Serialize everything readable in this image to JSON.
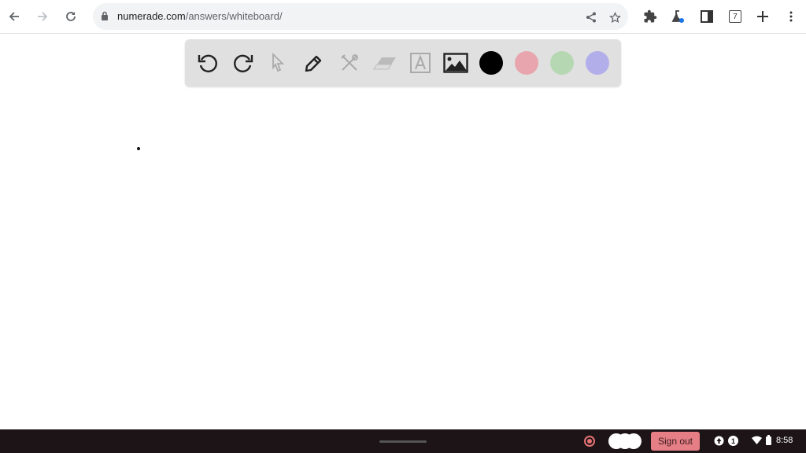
{
  "browser": {
    "url_host": "numerade.com",
    "url_path": "/answers/whiteboard/",
    "tab_count": "7",
    "nav": {
      "back": "back-arrow",
      "forward": "forward-arrow",
      "reload": "reload"
    },
    "toolbar_icons": [
      "share",
      "bookmark-star",
      "extensions-puzzle",
      "labs-flask",
      "side-panel",
      "tab-count",
      "new-tab-plus",
      "menu-kebab"
    ]
  },
  "whiteboard": {
    "tools": [
      {
        "name": "undo",
        "enabled": true
      },
      {
        "name": "redo",
        "enabled": true
      },
      {
        "name": "select",
        "enabled": false
      },
      {
        "name": "pen",
        "enabled": true
      },
      {
        "name": "tools",
        "enabled": false
      },
      {
        "name": "eraser",
        "enabled": false
      },
      {
        "name": "text",
        "enabled": false
      },
      {
        "name": "image",
        "enabled": true
      }
    ],
    "colors": [
      {
        "name": "black",
        "hex": "#000000"
      },
      {
        "name": "pink",
        "hex": "#e8a5ad"
      },
      {
        "name": "green",
        "hex": "#b5d8b3"
      },
      {
        "name": "purple",
        "hex": "#b2aeea"
      }
    ]
  },
  "shelf": {
    "sign_out_label": "Sign out",
    "notification_count": "1",
    "time": "8:58"
  }
}
